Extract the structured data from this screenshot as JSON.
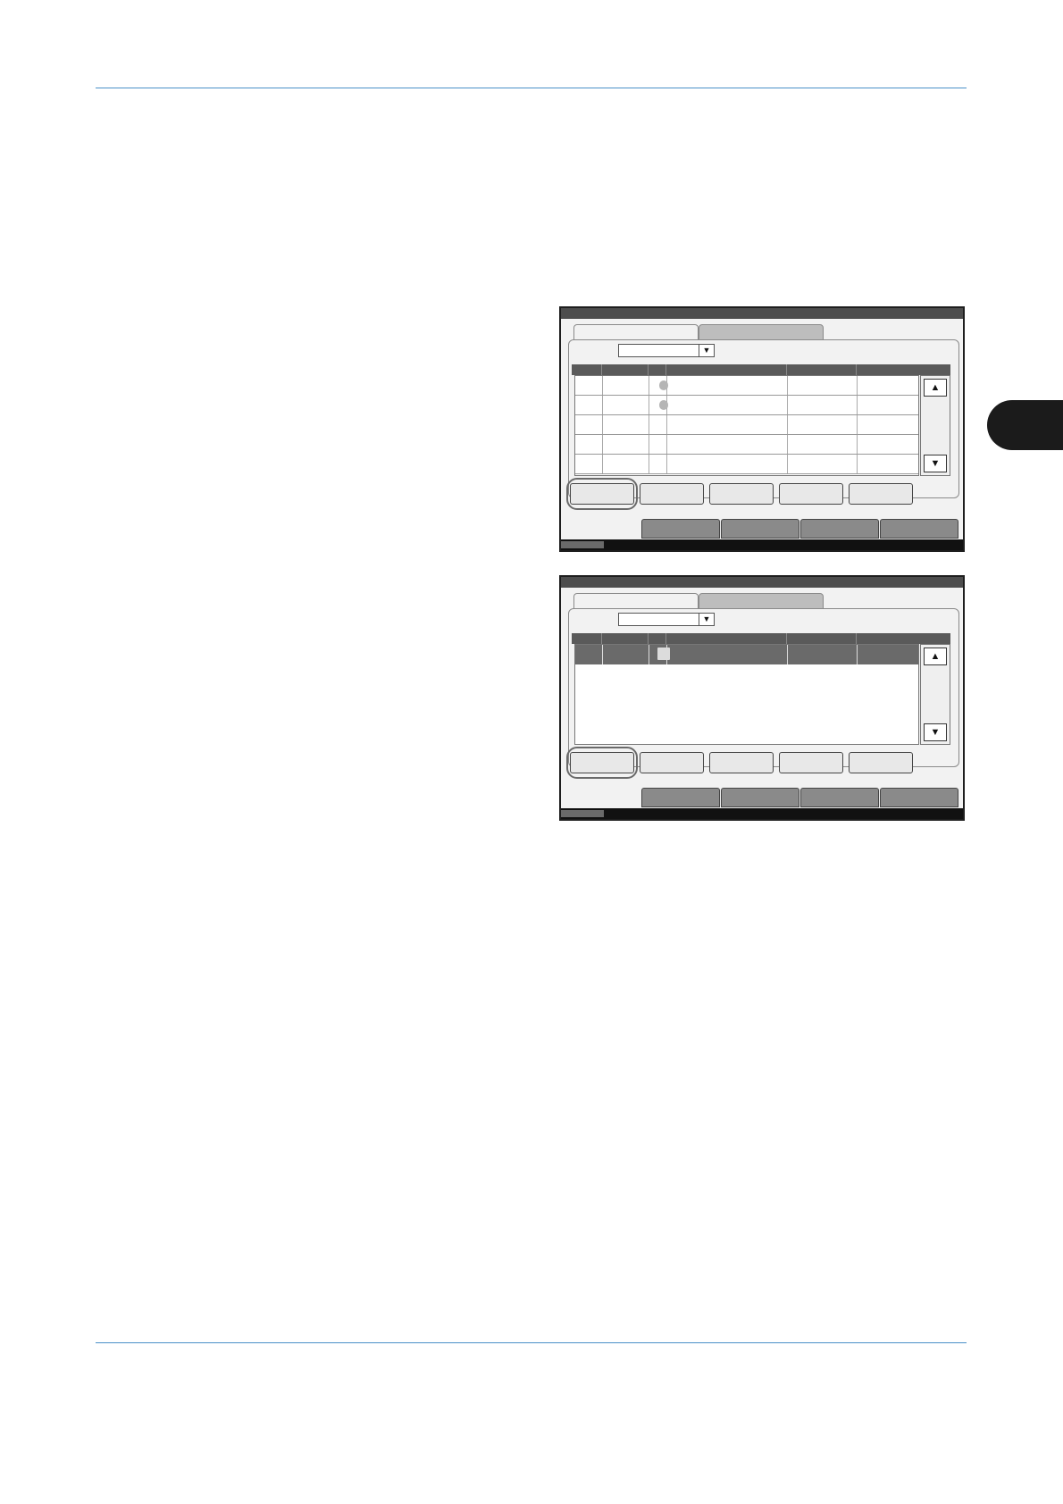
{
  "page": {
    "chapter_tab": {
      "text": ""
    }
  },
  "screens": [
    {
      "id": "screen-1",
      "dropdown": {
        "value": ""
      },
      "rows": [
        {
          "selected": false,
          "icon": "document-icon"
        },
        {
          "selected": false,
          "icon": "document-icon"
        },
        {
          "selected": false,
          "icon": ""
        },
        {
          "selected": false,
          "icon": ""
        },
        {
          "selected": false,
          "icon": ""
        }
      ],
      "buttons": [
        "",
        "",
        "",
        "",
        ""
      ],
      "highlighted_button_index": 0,
      "bottom_tabs": [
        "",
        "",
        "",
        "",
        ""
      ]
    },
    {
      "id": "screen-2",
      "dropdown": {
        "value": ""
      },
      "rows": [
        {
          "selected": true,
          "icon": "document-icon"
        }
      ],
      "buttons": [
        "",
        "",
        "",
        "",
        ""
      ],
      "highlighted_button_index": 0,
      "bottom_tabs": [
        "",
        "",
        "",
        "",
        ""
      ]
    }
  ],
  "icons": {
    "scroll_up": "▲",
    "scroll_down": "▼",
    "dropdown_arrow": "▼"
  }
}
